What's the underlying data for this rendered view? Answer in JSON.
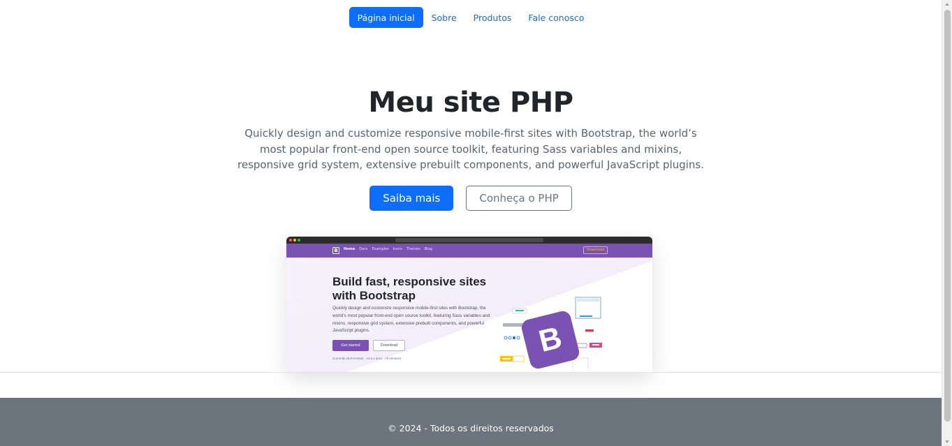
{
  "nav": {
    "items": [
      {
        "label": "Página inicial",
        "active": true
      },
      {
        "label": "Sobre",
        "active": false
      },
      {
        "label": "Produtos",
        "active": false
      },
      {
        "label": "Fale conosco",
        "active": false
      }
    ]
  },
  "hero": {
    "title": "Meu site PHP",
    "lead": "Quickly design and customize responsive mobile-first sites with Bootstrap, the world’s most popular front-end open source toolkit, featuring Sass variables and mixins, responsive grid system, extensive prebuilt components, and powerful JavaScript plugins.",
    "primary_button": "Saiba mais",
    "secondary_button": "Conheça o PHP"
  },
  "screenshot": {
    "menu": [
      "Home",
      "Docs",
      "Examples",
      "Icons",
      "Themes",
      "Blog"
    ],
    "download": "Download",
    "brand_letter": "B",
    "headline": "Build fast, responsive sites with Bootstrap",
    "text": "Quickly design and customize responsive mobile-first sites with Bootstrap, the world's most popular front-end open source toolkit, featuring Sass variables and mixins, responsive grid system, extensive prebuilt components, and powerful JavaScript plugins.",
    "get_started": "Get started",
    "download_btn": "Download",
    "version": "Currently v5.0.0-beta2 · v4.6.x docs · All releases"
  },
  "footer": {
    "text": "© 2024 - Todos os direitos reservados"
  },
  "colors": {
    "primary": "#0d6efd",
    "footer_bg": "#6c757d",
    "bootstrap_purple": "#7952b3"
  }
}
